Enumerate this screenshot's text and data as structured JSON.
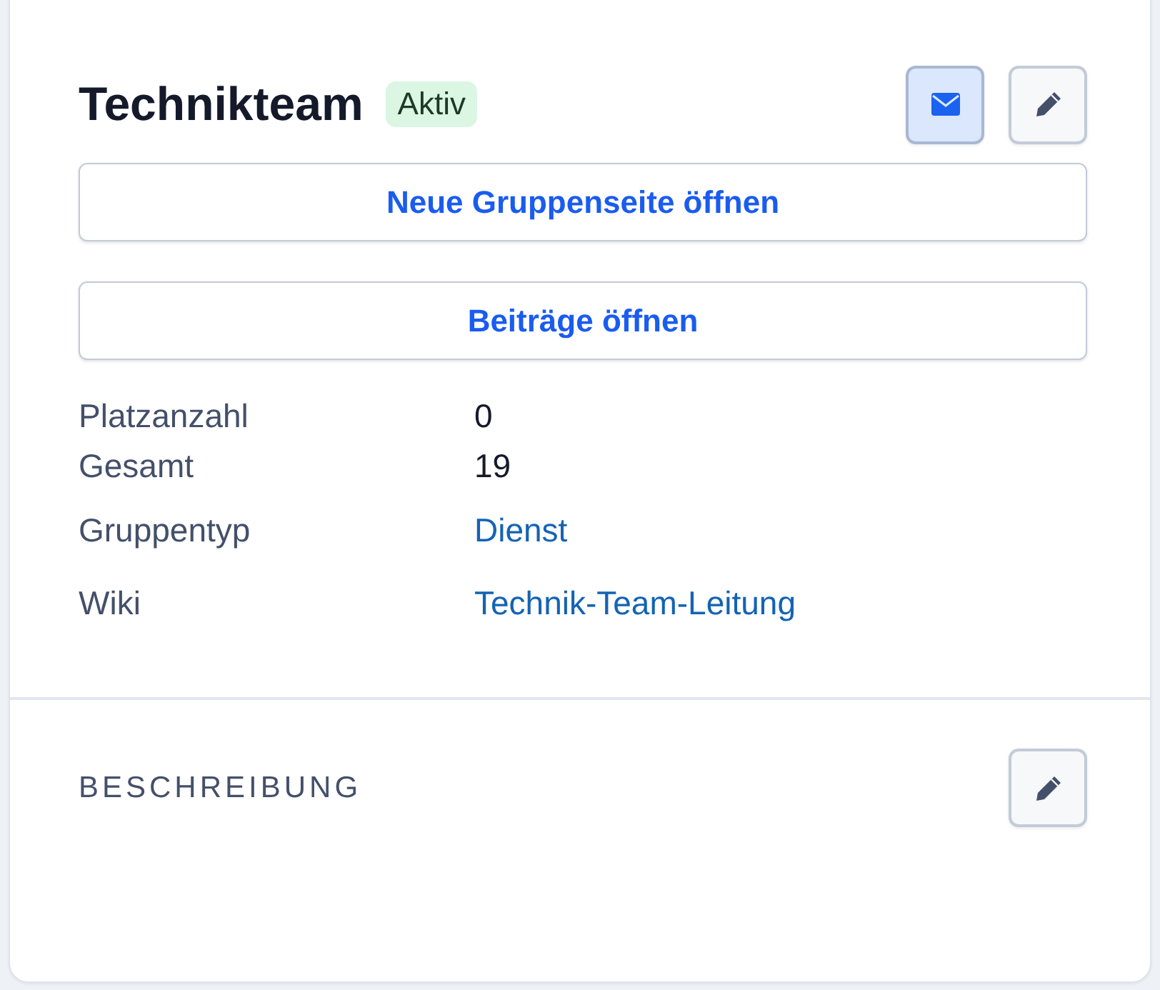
{
  "title": "Technikteam",
  "status_badge": "Aktiv",
  "header_actions": [
    {
      "kind": "mail",
      "highlighted": true
    },
    {
      "kind": "edit",
      "highlighted": false
    }
  ],
  "buttons": [
    "Neue Gruppenseite öffnen",
    "Beiträge öffnen"
  ],
  "counts": [
    {
      "label": "Platzanzahl",
      "value": "0"
    },
    {
      "label": "Gesamt",
      "value": "19"
    }
  ],
  "properties": [
    {
      "label": "Gruppentyp",
      "value": "Dienst",
      "kind": "link"
    },
    {
      "label": "Wiki",
      "value": "Technik-Team-Leitung",
      "kind": "link"
    }
  ],
  "description_section": {
    "heading": "BESCHREIBUNG",
    "actions": [
      {
        "kind": "edit"
      }
    ]
  }
}
